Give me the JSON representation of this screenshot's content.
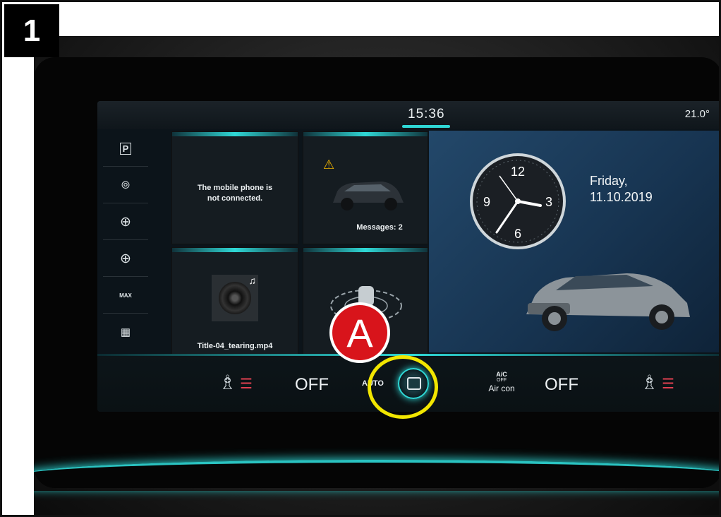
{
  "step_number": "1",
  "status": {
    "time": "15:36",
    "temperature": "21.0°"
  },
  "sidebar": {
    "items": [
      {
        "name": "parking-icon",
        "glyph": "P"
      },
      {
        "name": "help-icon",
        "glyph": "⦾"
      },
      {
        "name": "crosshair-icon",
        "glyph": "⊕"
      },
      {
        "name": "crosshair-icon-2",
        "glyph": "⊕"
      },
      {
        "name": "max-defrost-icon",
        "glyph": "MAX"
      },
      {
        "name": "rear-defrost-icon",
        "glyph": "▦"
      }
    ]
  },
  "tiles": {
    "phone": {
      "text": "The mobile phone is not connected."
    },
    "car_status": {
      "warning_glyph": "⚠",
      "text": "Messages: 2"
    },
    "media": {
      "text": "Title-04_tearing.mp4"
    },
    "driving": {}
  },
  "right_panel": {
    "clock": {
      "hour_labels": [
        "12",
        "3",
        "6",
        "9"
      ]
    },
    "date_line1": "Friday,",
    "date_line2": "11.10.2019"
  },
  "climate": {
    "left_off": "OFF",
    "auto": "AUTO",
    "ac_label_top": "A/C",
    "ac_label_mid": "OFF",
    "ac_label": "Air con",
    "right_off": "OFF"
  },
  "annotation": {
    "marker_label": "A",
    "ring_color": "#f2e600",
    "marker_color": "#d8141b"
  },
  "colors": {
    "accent": "#2fd8d6",
    "seat_heat": "#e04050"
  }
}
